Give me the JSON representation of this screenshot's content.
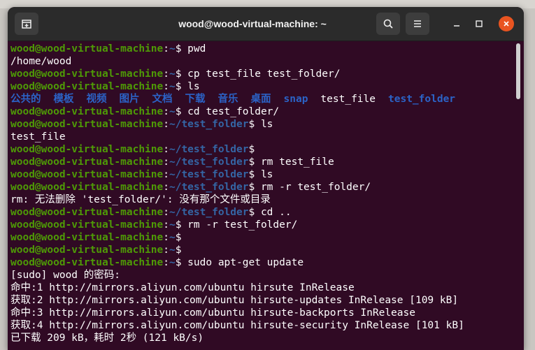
{
  "window": {
    "title": "wood@wood-virtual-machine: ~"
  },
  "icons": {
    "new_tab": "new-tab-icon",
    "search": "search-icon",
    "menu": "hamburger-menu-icon",
    "minimize": "minimize-icon",
    "maximize": "maximize-icon",
    "close": "close-icon"
  },
  "colors": {
    "terminal_bg": "#300a24",
    "prompt_user": "#4e9a06",
    "prompt_path": "#3465a4",
    "close_button": "#e95420"
  },
  "terminal": {
    "prompt_user": "wood@wood-virtual-machine",
    "lines": [
      {
        "type": "prompt",
        "path": "~",
        "cmd": " pwd"
      },
      {
        "type": "output",
        "text": "/home/wood"
      },
      {
        "type": "prompt",
        "path": "~",
        "cmd": " cp test_file test_folder/"
      },
      {
        "type": "prompt",
        "path": "~",
        "cmd": " ls"
      },
      {
        "type": "ls",
        "items": [
          {
            "name": "公共的",
            "dir": true
          },
          {
            "name": "模板",
            "dir": true
          },
          {
            "name": "视频",
            "dir": true
          },
          {
            "name": "图片",
            "dir": true
          },
          {
            "name": "文档",
            "dir": true
          },
          {
            "name": "下载",
            "dir": true
          },
          {
            "name": "音乐",
            "dir": true
          },
          {
            "name": "桌面",
            "dir": true
          },
          {
            "name": "snap",
            "dir": true
          },
          {
            "name": "test_file",
            "dir": false
          },
          {
            "name": "test_folder",
            "dir": true
          }
        ]
      },
      {
        "type": "prompt",
        "path": "~",
        "cmd": " cd test_folder/"
      },
      {
        "type": "prompt",
        "path": "~/test_folder",
        "cmd": " ls"
      },
      {
        "type": "output",
        "text": "test_file"
      },
      {
        "type": "prompt",
        "path": "~/test_folder",
        "cmd": ""
      },
      {
        "type": "prompt",
        "path": "~/test_folder",
        "cmd": " rm test_file"
      },
      {
        "type": "prompt",
        "path": "~/test_folder",
        "cmd": " ls"
      },
      {
        "type": "prompt",
        "path": "~/test_folder",
        "cmd": " rm -r test_folder/"
      },
      {
        "type": "output",
        "text": "rm: 无法删除 'test_folder/': 没有那个文件或目录"
      },
      {
        "type": "prompt",
        "path": "~/test_folder",
        "cmd": " cd .."
      },
      {
        "type": "prompt",
        "path": "~",
        "cmd": " rm -r test_folder/"
      },
      {
        "type": "prompt",
        "path": "~",
        "cmd": ""
      },
      {
        "type": "prompt",
        "path": "~",
        "cmd": ""
      },
      {
        "type": "prompt",
        "path": "~",
        "cmd": " sudo apt-get update"
      },
      {
        "type": "output",
        "text": "[sudo] wood 的密码:"
      },
      {
        "type": "output",
        "text": "命中:1 http://mirrors.aliyun.com/ubuntu hirsute InRelease"
      },
      {
        "type": "output",
        "text": "获取:2 http://mirrors.aliyun.com/ubuntu hirsute-updates InRelease [109 kB]"
      },
      {
        "type": "output",
        "text": "命中:3 http://mirrors.aliyun.com/ubuntu hirsute-backports InRelease"
      },
      {
        "type": "output",
        "text": "获取:4 http://mirrors.aliyun.com/ubuntu hirsute-security InRelease [101 kB]"
      },
      {
        "type": "output",
        "text": "已下载 209 kB，耗时 2秒 (121 kB/s)"
      }
    ]
  }
}
